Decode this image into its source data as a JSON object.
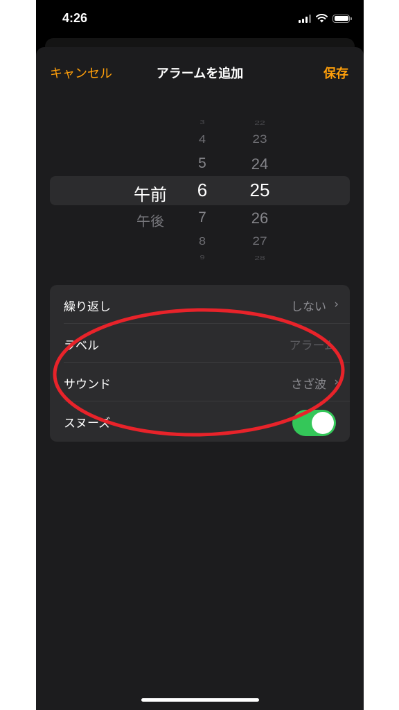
{
  "status_bar": {
    "time": "4:26"
  },
  "nav": {
    "cancel": "キャンセル",
    "title": "アラームを追加",
    "save": "保存"
  },
  "picker": {
    "ampm": {
      "above": "",
      "selected": "午前",
      "below": "午後"
    },
    "hours": [
      "3",
      "4",
      "5",
      "6",
      "7",
      "8",
      "9"
    ],
    "minutes": [
      "22",
      "23",
      "24",
      "25",
      "26",
      "27",
      "28"
    ],
    "selected_hour": "6",
    "selected_minute": "25"
  },
  "settings": {
    "repeat": {
      "label": "繰り返し",
      "value": "しない"
    },
    "label": {
      "label": "ラベル",
      "placeholder": "アラーム"
    },
    "sound": {
      "label": "サウンド",
      "value": "さざ波"
    },
    "snooze": {
      "label": "スヌーズ",
      "on": true
    }
  },
  "colors": {
    "accent": "#ff9f0a",
    "toggle_on": "#34c759",
    "annotation": "#e8232a"
  }
}
